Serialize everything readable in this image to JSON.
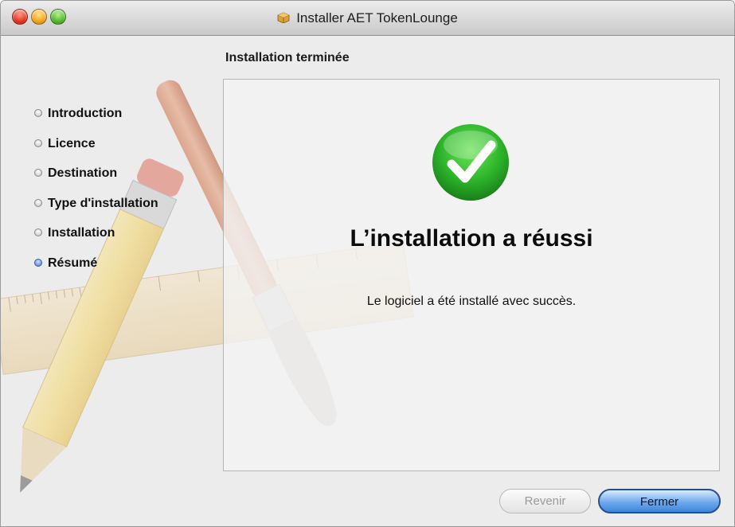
{
  "window": {
    "title": "Installer AET TokenLounge"
  },
  "page": {
    "heading": "Installation terminée"
  },
  "sidebar": {
    "steps": [
      {
        "label": "Introduction",
        "active": false
      },
      {
        "label": "Licence",
        "active": false
      },
      {
        "label": "Destination",
        "active": false
      },
      {
        "label": "Type d'installation",
        "active": false
      },
      {
        "label": "Installation",
        "active": false
      },
      {
        "label": "Résumé",
        "active": true
      }
    ]
  },
  "content": {
    "icon": "success-checkmark-icon",
    "heading": "L’installation a réussi",
    "message": "Le logiciel a été installé avec succès."
  },
  "buttons": {
    "back_label": "Revenir",
    "back_enabled": false,
    "close_label": "Fermer"
  },
  "colors": {
    "success_green": "#2db52a",
    "accent_blue": "#3c78d8"
  }
}
